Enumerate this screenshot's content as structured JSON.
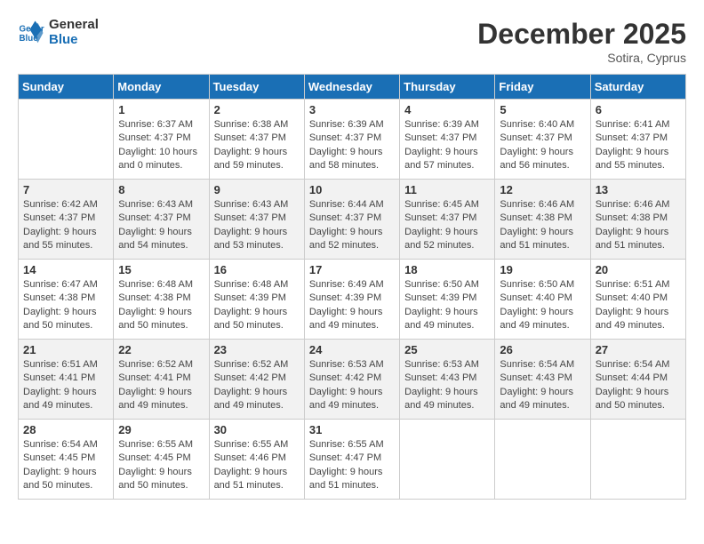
{
  "header": {
    "logo_line1": "General",
    "logo_line2": "Blue",
    "month_year": "December 2025",
    "location": "Sotira, Cyprus"
  },
  "weekdays": [
    "Sunday",
    "Monday",
    "Tuesday",
    "Wednesday",
    "Thursday",
    "Friday",
    "Saturday"
  ],
  "weeks": [
    [
      {
        "day": "",
        "info": ""
      },
      {
        "day": "1",
        "info": "Sunrise: 6:37 AM\nSunset: 4:37 PM\nDaylight: 10 hours\nand 0 minutes."
      },
      {
        "day": "2",
        "info": "Sunrise: 6:38 AM\nSunset: 4:37 PM\nDaylight: 9 hours\nand 59 minutes."
      },
      {
        "day": "3",
        "info": "Sunrise: 6:39 AM\nSunset: 4:37 PM\nDaylight: 9 hours\nand 58 minutes."
      },
      {
        "day": "4",
        "info": "Sunrise: 6:39 AM\nSunset: 4:37 PM\nDaylight: 9 hours\nand 57 minutes."
      },
      {
        "day": "5",
        "info": "Sunrise: 6:40 AM\nSunset: 4:37 PM\nDaylight: 9 hours\nand 56 minutes."
      },
      {
        "day": "6",
        "info": "Sunrise: 6:41 AM\nSunset: 4:37 PM\nDaylight: 9 hours\nand 55 minutes."
      }
    ],
    [
      {
        "day": "7",
        "info": "Sunrise: 6:42 AM\nSunset: 4:37 PM\nDaylight: 9 hours\nand 55 minutes."
      },
      {
        "day": "8",
        "info": "Sunrise: 6:43 AM\nSunset: 4:37 PM\nDaylight: 9 hours\nand 54 minutes."
      },
      {
        "day": "9",
        "info": "Sunrise: 6:43 AM\nSunset: 4:37 PM\nDaylight: 9 hours\nand 53 minutes."
      },
      {
        "day": "10",
        "info": "Sunrise: 6:44 AM\nSunset: 4:37 PM\nDaylight: 9 hours\nand 52 minutes."
      },
      {
        "day": "11",
        "info": "Sunrise: 6:45 AM\nSunset: 4:37 PM\nDaylight: 9 hours\nand 52 minutes."
      },
      {
        "day": "12",
        "info": "Sunrise: 6:46 AM\nSunset: 4:38 PM\nDaylight: 9 hours\nand 51 minutes."
      },
      {
        "day": "13",
        "info": "Sunrise: 6:46 AM\nSunset: 4:38 PM\nDaylight: 9 hours\nand 51 minutes."
      }
    ],
    [
      {
        "day": "14",
        "info": "Sunrise: 6:47 AM\nSunset: 4:38 PM\nDaylight: 9 hours\nand 50 minutes."
      },
      {
        "day": "15",
        "info": "Sunrise: 6:48 AM\nSunset: 4:38 PM\nDaylight: 9 hours\nand 50 minutes."
      },
      {
        "day": "16",
        "info": "Sunrise: 6:48 AM\nSunset: 4:39 PM\nDaylight: 9 hours\nand 50 minutes."
      },
      {
        "day": "17",
        "info": "Sunrise: 6:49 AM\nSunset: 4:39 PM\nDaylight: 9 hours\nand 49 minutes."
      },
      {
        "day": "18",
        "info": "Sunrise: 6:50 AM\nSunset: 4:39 PM\nDaylight: 9 hours\nand 49 minutes."
      },
      {
        "day": "19",
        "info": "Sunrise: 6:50 AM\nSunset: 4:40 PM\nDaylight: 9 hours\nand 49 minutes."
      },
      {
        "day": "20",
        "info": "Sunrise: 6:51 AM\nSunset: 4:40 PM\nDaylight: 9 hours\nand 49 minutes."
      }
    ],
    [
      {
        "day": "21",
        "info": "Sunrise: 6:51 AM\nSunset: 4:41 PM\nDaylight: 9 hours\nand 49 minutes."
      },
      {
        "day": "22",
        "info": "Sunrise: 6:52 AM\nSunset: 4:41 PM\nDaylight: 9 hours\nand 49 minutes."
      },
      {
        "day": "23",
        "info": "Sunrise: 6:52 AM\nSunset: 4:42 PM\nDaylight: 9 hours\nand 49 minutes."
      },
      {
        "day": "24",
        "info": "Sunrise: 6:53 AM\nSunset: 4:42 PM\nDaylight: 9 hours\nand 49 minutes."
      },
      {
        "day": "25",
        "info": "Sunrise: 6:53 AM\nSunset: 4:43 PM\nDaylight: 9 hours\nand 49 minutes."
      },
      {
        "day": "26",
        "info": "Sunrise: 6:54 AM\nSunset: 4:43 PM\nDaylight: 9 hours\nand 49 minutes."
      },
      {
        "day": "27",
        "info": "Sunrise: 6:54 AM\nSunset: 4:44 PM\nDaylight: 9 hours\nand 50 minutes."
      }
    ],
    [
      {
        "day": "28",
        "info": "Sunrise: 6:54 AM\nSunset: 4:45 PM\nDaylight: 9 hours\nand 50 minutes."
      },
      {
        "day": "29",
        "info": "Sunrise: 6:55 AM\nSunset: 4:45 PM\nDaylight: 9 hours\nand 50 minutes."
      },
      {
        "day": "30",
        "info": "Sunrise: 6:55 AM\nSunset: 4:46 PM\nDaylight: 9 hours\nand 51 minutes."
      },
      {
        "day": "31",
        "info": "Sunrise: 6:55 AM\nSunset: 4:47 PM\nDaylight: 9 hours\nand 51 minutes."
      },
      {
        "day": "",
        "info": ""
      },
      {
        "day": "",
        "info": ""
      },
      {
        "day": "",
        "info": ""
      }
    ]
  ]
}
